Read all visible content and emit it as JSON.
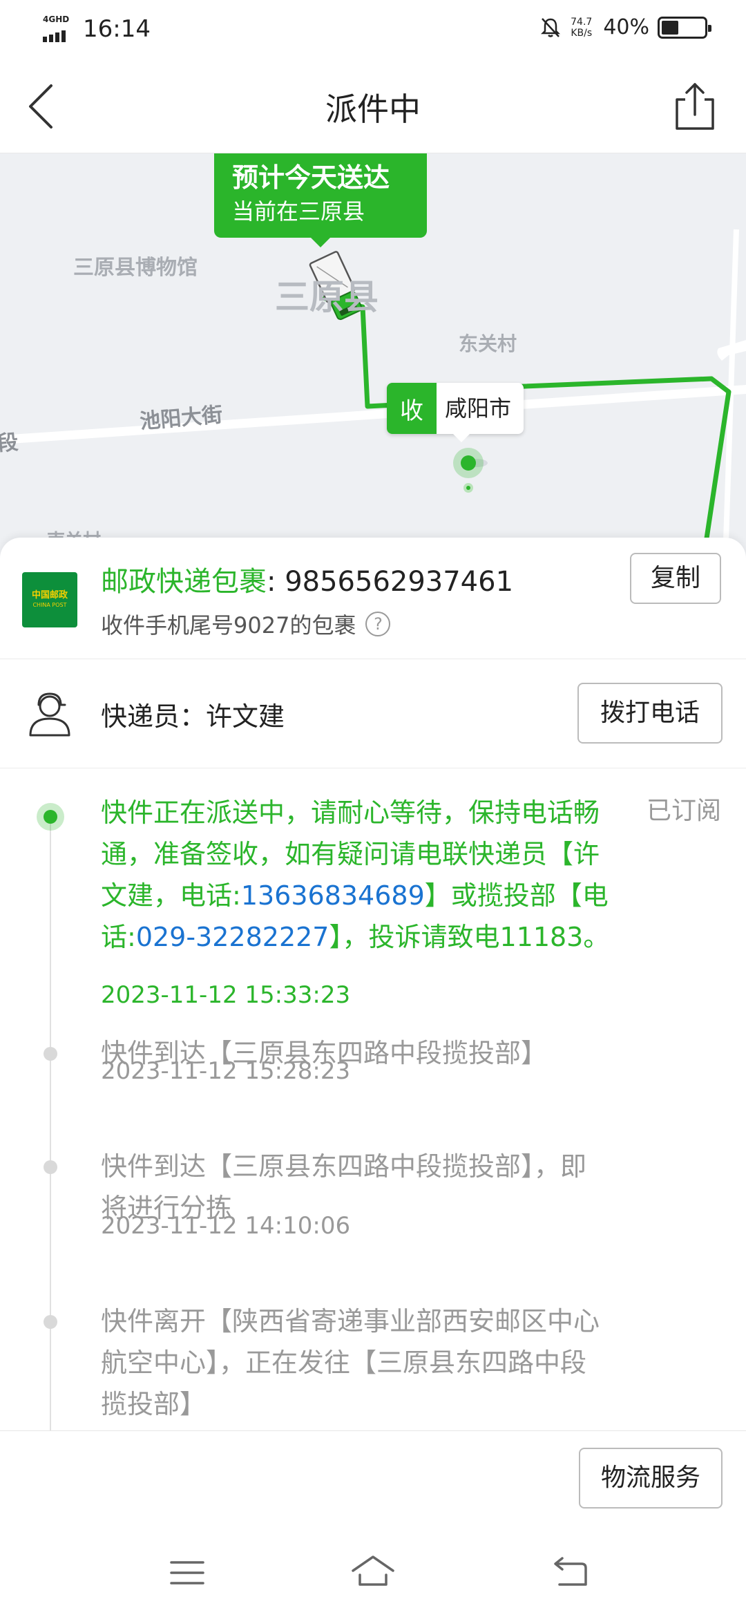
{
  "status_bar": {
    "network": "4GHD",
    "time": "16:14",
    "speed_value": "74.7",
    "speed_unit": "KB/s",
    "battery": "40%",
    "battery_fraction": 0.4
  },
  "header": {
    "title": "派件中"
  },
  "map": {
    "eta_title": "预计今天送达",
    "eta_sub": "当前在三原县",
    "labels": {
      "museum": "三原县博物馆",
      "county": "三原县",
      "village": "东关村",
      "street": "池阳大街",
      "segment": "段",
      "south_village": "南关村"
    },
    "recv_tag": "收",
    "recv_city": "咸阳市"
  },
  "package": {
    "carrier": "邮政快递包裹",
    "number": ": 9856562937461",
    "subtitle": "收件手机尾号9027的包裹",
    "help": "?",
    "copy_label": "复制",
    "logo_cn": "中国邮政",
    "logo_en": "CHINA POST"
  },
  "courier": {
    "label": "快递员：许文建",
    "call_label": "拨打电话"
  },
  "timeline": {
    "subscribed": "已订阅",
    "events": [
      {
        "text_a": "快件正在派送中，请耐心等待，保持电话畅通，准备签收，如有疑问请电联快递员【许文建，电话:",
        "phone_a": "13636834689",
        "text_b": "】或揽投部【电话:",
        "phone_b": "029-32282227",
        "text_c": "】，投诉请致电11183。",
        "time": "2023-11-12 15:33:23"
      },
      {
        "text": "快件到达【三原县东四路中段揽投部】",
        "time": "2023-11-12 15:28:23"
      },
      {
        "text": "快件到达【三原县东四路中段揽投部】，即将进行分拣",
        "time": "2023-11-12 14:10:06"
      },
      {
        "text": "快件离开【陕西省寄递事业部西安邮区中心航空中心】，正在发往【三原县东四路中段揽投部】"
      }
    ]
  },
  "footer": {
    "service_label": "物流服务"
  },
  "icons": {
    "back": "back-arrow-icon",
    "share": "share-icon",
    "courier": "courier-person-icon",
    "menu": "menu-icon",
    "home": "home-icon",
    "return": "return-icon"
  },
  "colors": {
    "accent": "#2bb52b",
    "link": "#1a73d1",
    "muted": "#999999"
  }
}
